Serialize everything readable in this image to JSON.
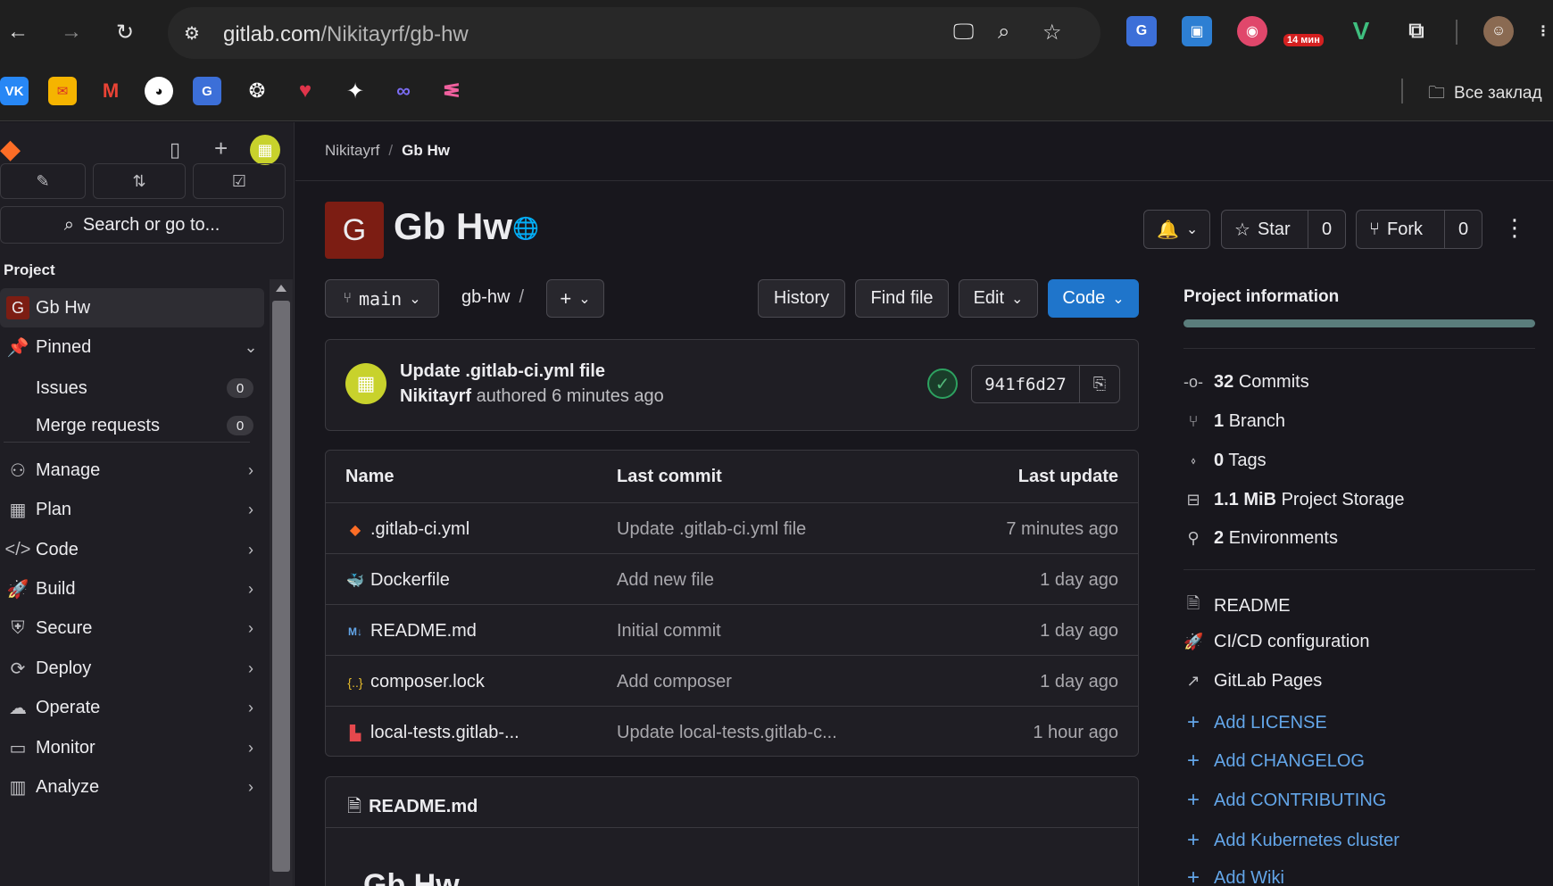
{
  "browser": {
    "url_host": "gitlab.com",
    "url_path": "/Nikitayrf/gb-hw",
    "extension_badge": "14 мин",
    "bookmarks_folder": "Все заклад"
  },
  "sidebar": {
    "search_label": "Search or go to...",
    "section_label": "Project",
    "project_item": {
      "icon_letter": "G",
      "label": "Gb Hw"
    },
    "pinned": {
      "label": "Pinned"
    },
    "pinned_items": [
      {
        "label": "Issues",
        "count": "0"
      },
      {
        "label": "Merge requests",
        "count": "0"
      }
    ],
    "nav_items": [
      {
        "label": "Manage",
        "icon": "users-icon"
      },
      {
        "label": "Plan",
        "icon": "calendar-icon"
      },
      {
        "label": "Code",
        "icon": "code-icon"
      },
      {
        "label": "Build",
        "icon": "rocket-icon"
      },
      {
        "label": "Secure",
        "icon": "shield-icon"
      },
      {
        "label": "Deploy",
        "icon": "deploy-icon"
      },
      {
        "label": "Operate",
        "icon": "cloud-gear-icon"
      },
      {
        "label": "Monitor",
        "icon": "monitor-icon"
      },
      {
        "label": "Analyze",
        "icon": "chart-icon"
      }
    ]
  },
  "breadcrumb": {
    "owner": "Nikitayrf",
    "project": "Gb Hw"
  },
  "project": {
    "avatar_letter": "G",
    "title": "Gb Hw",
    "star_label": "Star",
    "star_count": "0",
    "fork_label": "Fork",
    "fork_count": "0"
  },
  "repo_toolbar": {
    "branch": "main",
    "path": "gb-hw",
    "path_sep": "/",
    "history_label": "History",
    "find_file_label": "Find file",
    "edit_label": "Edit",
    "code_label": "Code"
  },
  "last_commit": {
    "title": "Update .gitlab-ci.yml file",
    "author": "Nikitayrf",
    "authored_text": "authored 6 minutes ago",
    "sha": "941f6d27",
    "pipeline_status": "passed"
  },
  "file_table": {
    "headers": {
      "name": "Name",
      "last_commit": "Last commit",
      "last_update": "Last update"
    },
    "rows": [
      {
        "name": ".gitlab-ci.yml",
        "icon": "gitlab-icon",
        "commit": "Update .gitlab-ci.yml file",
        "updated": "7 minutes ago"
      },
      {
        "name": "Dockerfile",
        "icon": "docker-icon",
        "commit": "Add new file",
        "updated": "1 day ago"
      },
      {
        "name": "README.md",
        "icon": "markdown-icon",
        "commit": "Initial commit",
        "updated": "1 day ago"
      },
      {
        "name": "composer.lock",
        "icon": "json-icon",
        "commit": "Add composer",
        "updated": "1 day ago"
      },
      {
        "name": "local-tests.gitlab-...",
        "icon": "file-red-icon",
        "commit": "Update local-tests.gitlab-c...",
        "updated": "1 hour ago"
      }
    ]
  },
  "readme": {
    "filename": "README.md",
    "heading": "Gb Hw"
  },
  "project_info": {
    "title": "Project information",
    "stats": [
      {
        "value": "32",
        "label": "Commits",
        "icon": "commit-icon"
      },
      {
        "value": "1",
        "label": "Branch",
        "icon": "branch-icon"
      },
      {
        "value": "0",
        "label": "Tags",
        "icon": "tag-icon"
      },
      {
        "value": "1.1 MiB",
        "label": "Project Storage",
        "icon": "storage-icon"
      },
      {
        "value": "2",
        "label": "Environments",
        "icon": "environment-icon"
      }
    ],
    "links": [
      {
        "label": "README",
        "icon": "file-icon"
      },
      {
        "label": "CI/CD configuration",
        "icon": "rocket-icon"
      },
      {
        "label": "GitLab Pages",
        "icon": "external-link-icon"
      }
    ],
    "add_links": [
      {
        "label": "Add LICENSE"
      },
      {
        "label": "Add CHANGELOG"
      },
      {
        "label": "Add CONTRIBUTING"
      },
      {
        "label": "Add Kubernetes cluster"
      },
      {
        "label": "Add Wiki"
      }
    ]
  }
}
